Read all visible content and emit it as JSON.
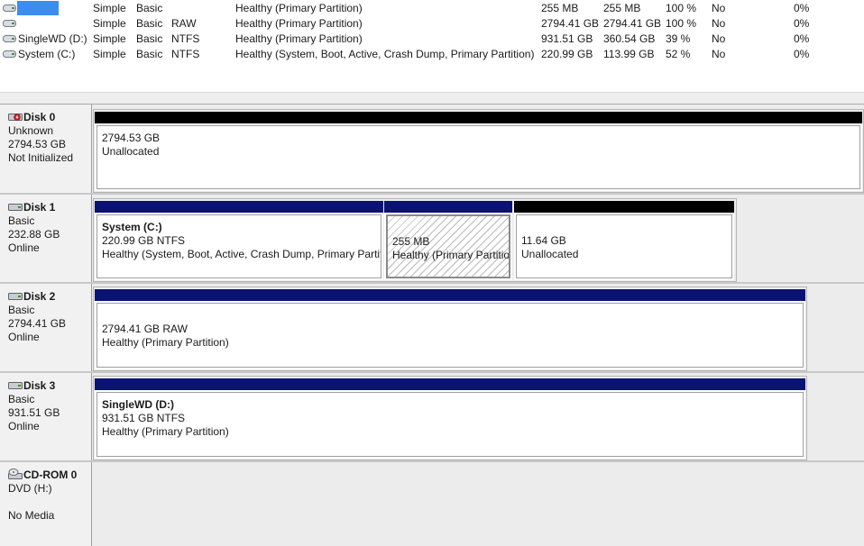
{
  "volumes": [
    {
      "name": "",
      "layout": "Simple",
      "type": "Basic",
      "fs": "",
      "status": "Healthy (Primary Partition)",
      "capacity": "255 MB",
      "free": "255 MB",
      "pct_free": "100 %",
      "fault_tolerance": "No",
      "overhead": "0%",
      "icon": "volume-icon",
      "selected": true
    },
    {
      "name": "",
      "layout": "Simple",
      "type": "Basic",
      "fs": "RAW",
      "status": "Healthy (Primary Partition)",
      "capacity": "2794.41 GB",
      "free": "2794.41 GB",
      "pct_free": "100 %",
      "fault_tolerance": "No",
      "overhead": "0%",
      "icon": "volume-icon"
    },
    {
      "name": "SingleWD (D:)",
      "layout": "Simple",
      "type": "Basic",
      "fs": "NTFS",
      "status": "Healthy (Primary Partition)",
      "capacity": "931.51 GB",
      "free": "360.54 GB",
      "pct_free": "39 %",
      "fault_tolerance": "No",
      "overhead": "0%",
      "icon": "volume-icon"
    },
    {
      "name": "System (C:)",
      "layout": "Simple",
      "type": "Basic",
      "fs": "NTFS",
      "status": "Healthy (System, Boot, Active, Crash Dump, Primary Partition)",
      "capacity": "220.99 GB",
      "free": "113.99 GB",
      "pct_free": "52 %",
      "fault_tolerance": "No",
      "overhead": "0%",
      "icon": "volume-icon"
    }
  ],
  "disks": [
    {
      "title": "Disk 0",
      "type": "Unknown",
      "size": "2794.53 GB",
      "state": "Not Initialized",
      "icon": "disk-warning-icon",
      "partitions": [
        {
          "line1": "2794.53 GB",
          "line2": "Unallocated"
        }
      ]
    },
    {
      "title": "Disk 1",
      "type": "Basic",
      "size": "232.88 GB",
      "state": "Online",
      "icon": "disk-icon",
      "partitions": [
        {
          "title": "System  (C:)",
          "line1": "220.99 GB NTFS",
          "line2": "Healthy (System, Boot, Active, Crash Dump, Primary Partition)"
        },
        {
          "line1": "255 MB",
          "line2": "Healthy (Primary Partition)"
        },
        {
          "line1": "11.64 GB",
          "line2": "Unallocated"
        }
      ]
    },
    {
      "title": "Disk 2",
      "type": "Basic",
      "size": "2794.41 GB",
      "state": "Online",
      "icon": "disk-icon",
      "partitions": [
        {
          "line1": "2794.41 GB RAW",
          "line2": "Healthy (Primary Partition)"
        }
      ]
    },
    {
      "title": "Disk 3",
      "type": "Basic",
      "size": "931.51 GB",
      "state": "Online",
      "icon": "disk-icon",
      "partitions": [
        {
          "title": "SingleWD  (D:)",
          "line1": "931.51 GB NTFS",
          "line2": "Healthy (Primary Partition)"
        }
      ]
    },
    {
      "title": "CD-ROM 0",
      "type": "DVD (H:)",
      "size": "",
      "state": "No Media",
      "icon": "cdrom-icon",
      "partitions": []
    }
  ],
  "colors": {
    "primary_bar": "#0a1273",
    "unallocated_bar": "#000000",
    "selection": "#3b8ef0"
  }
}
